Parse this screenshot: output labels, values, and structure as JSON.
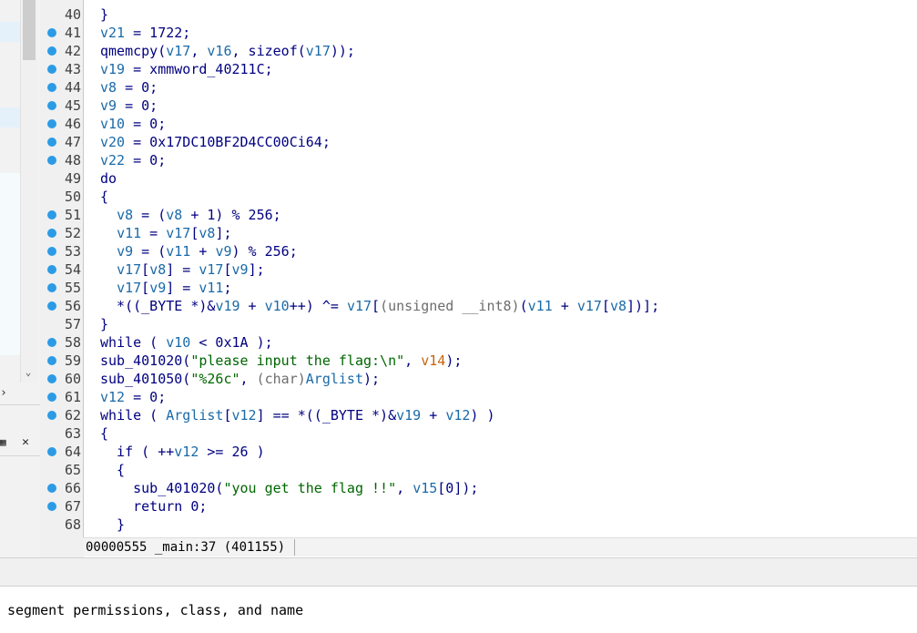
{
  "left_panel": {
    "expand_icon": "chevron-right-icon",
    "float_icon": "float-window-icon",
    "close_icon": "close-icon",
    "scroll_icon": "chevron-down-icon"
  },
  "breakpoint_color": "#2b9be6",
  "code_lines": [
    {
      "n": "40",
      "bp": false,
      "html": "}"
    },
    {
      "n": "41",
      "bp": true,
      "html": "<span class='c-var'>v21</span> = 1722;"
    },
    {
      "n": "42",
      "bp": true,
      "html": "qmemcpy(<span class='c-var'>v17</span>, <span class='c-var'>v16</span>, sizeof(<span class='c-var'>v17</span>));"
    },
    {
      "n": "43",
      "bp": true,
      "html": "<span class='c-var'>v19</span> = xmmword_40211C;"
    },
    {
      "n": "44",
      "bp": true,
      "html": "<span class='c-var'>v8</span> = 0;"
    },
    {
      "n": "45",
      "bp": true,
      "html": "<span class='c-var'>v9</span> = 0;"
    },
    {
      "n": "46",
      "bp": true,
      "html": "<span class='c-var'>v10</span> = 0;"
    },
    {
      "n": "47",
      "bp": true,
      "html": "<span class='c-var'>v20</span> = 0x17DC10BF2D4CC00Ci64;"
    },
    {
      "n": "48",
      "bp": true,
      "html": "<span class='c-var'>v22</span> = 0;"
    },
    {
      "n": "49",
      "bp": false,
      "html": "do"
    },
    {
      "n": "50",
      "bp": false,
      "html": "{"
    },
    {
      "n": "51",
      "bp": true,
      "html": "  <span class='c-var'>v8</span> = (<span class='c-var'>v8</span> + 1) % 256;"
    },
    {
      "n": "52",
      "bp": true,
      "html": "  <span class='c-var'>v11</span> = <span class='c-var'>v17</span>[<span class='c-var'>v8</span>];"
    },
    {
      "n": "53",
      "bp": true,
      "html": "  <span class='c-var'>v9</span> = (<span class='c-var'>v11</span> + <span class='c-var'>v9</span>) % 256;"
    },
    {
      "n": "54",
      "bp": true,
      "html": "  <span class='c-var'>v17</span>[<span class='c-var'>v8</span>] = <span class='c-var'>v17</span>[<span class='c-var'>v9</span>];"
    },
    {
      "n": "55",
      "bp": true,
      "html": "  <span class='c-var'>v17</span>[<span class='c-var'>v9</span>] = <span class='c-var'>v11</span>;"
    },
    {
      "n": "56",
      "bp": true,
      "html": "  *((_BYTE *)&amp;<span class='c-var'>v19</span> + <span class='c-var'>v10</span>++) ^= <span class='c-var'>v17</span>[<span class='c-gray'>(unsigned __int8)</span>(<span class='c-var'>v11</span> + <span class='c-var'>v17</span>[<span class='c-var'>v8</span>])];"
    },
    {
      "n": "57",
      "bp": false,
      "html": "}"
    },
    {
      "n": "58",
      "bp": true,
      "html": "while ( <span class='c-var'>v10</span> &lt; 0x1A );"
    },
    {
      "n": "59",
      "bp": true,
      "html": "sub_401020(<span class='c-str'>\"please input the flag:\\n\"</span>, <span class='c-orange'>v14</span>);"
    },
    {
      "n": "60",
      "bp": true,
      "html": "sub_401050(<span class='c-str'>\"%26c\"</span>, <span class='c-gray'>(char)</span><span class='c-var'>Arglist</span>);"
    },
    {
      "n": "61",
      "bp": true,
      "html": "<span class='c-var'>v12</span> = 0;"
    },
    {
      "n": "62",
      "bp": true,
      "html": "while ( <span class='c-var'>Arglist</span>[<span class='c-var'>v12</span>] == *((_BYTE *)&amp;<span class='c-var'>v19</span> + <span class='c-var'>v12</span>) )"
    },
    {
      "n": "63",
      "bp": false,
      "html": "{"
    },
    {
      "n": "64",
      "bp": true,
      "html": "  if ( ++<span class='c-var'>v12</span> &gt;= 26 )"
    },
    {
      "n": "65",
      "bp": false,
      "html": "  {"
    },
    {
      "n": "66",
      "bp": true,
      "html": "    sub_401020(<span class='c-str'>\"you get the flag !!\"</span>, <span class='c-var'>v15</span>[0]);"
    },
    {
      "n": "67",
      "bp": true,
      "html": "    return 0;"
    },
    {
      "n": "68",
      "bp": false,
      "html": "  }"
    }
  ],
  "status_bar": {
    "text": "00000555 _main:37 (401155)"
  },
  "output": {
    "text": "segment permissions, class, and name"
  }
}
